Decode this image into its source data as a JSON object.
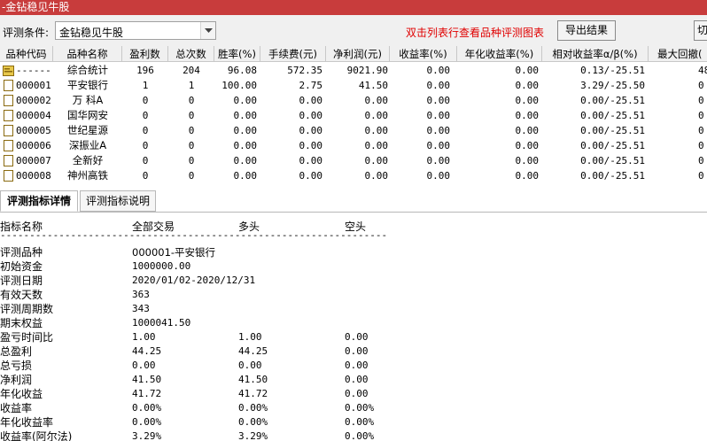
{
  "window": {
    "title": "-金钻稳见牛股"
  },
  "toolbar": {
    "condition_label": "评测条件:",
    "condition_value": "金钻稳见牛股",
    "hint": "双击列表行查看品种评测图表",
    "export_label": "导出结果",
    "cut_label": "切"
  },
  "table": {
    "columns": [
      "品种代码",
      "品种名称",
      "盈利数",
      "总次数",
      "胜率(%)",
      "手续费(元)",
      "净利润(元)",
      "收益率(%)",
      "年化收益率(%)",
      "相对收益率α/β(%)",
      "最大回撤("
    ],
    "rows": [
      {
        "code": "------",
        "name": "综合统计",
        "wins": "196",
        "total": "204",
        "winrate": "96.08",
        "fee": "572.35",
        "profit": "9021.90",
        "yield": "0.00",
        "annual": "0.00",
        "relative": "0.13/-25.51",
        "drawdown": "48"
      },
      {
        "code": "000001",
        "name": "平安银行",
        "wins": "1",
        "total": "1",
        "winrate": "100.00",
        "fee": "2.75",
        "profit": "41.50",
        "yield": "0.00",
        "annual": "0.00",
        "relative": "3.29/-25.50",
        "drawdown": "0"
      },
      {
        "code": "000002",
        "name": "万 科A",
        "wins": "0",
        "total": "0",
        "winrate": "0.00",
        "fee": "0.00",
        "profit": "0.00",
        "yield": "0.00",
        "annual": "0.00",
        "relative": "0.00/-25.51",
        "drawdown": "0"
      },
      {
        "code": "000004",
        "name": "国华网安",
        "wins": "0",
        "total": "0",
        "winrate": "0.00",
        "fee": "0.00",
        "profit": "0.00",
        "yield": "0.00",
        "annual": "0.00",
        "relative": "0.00/-25.51",
        "drawdown": "0"
      },
      {
        "code": "000005",
        "name": "世纪星源",
        "wins": "0",
        "total": "0",
        "winrate": "0.00",
        "fee": "0.00",
        "profit": "0.00",
        "yield": "0.00",
        "annual": "0.00",
        "relative": "0.00/-25.51",
        "drawdown": "0"
      },
      {
        "code": "000006",
        "name": "深振业A",
        "wins": "0",
        "total": "0",
        "winrate": "0.00",
        "fee": "0.00",
        "profit": "0.00",
        "yield": "0.00",
        "annual": "0.00",
        "relative": "0.00/-25.51",
        "drawdown": "0"
      },
      {
        "code": "000007",
        "name": "全新好",
        "wins": "0",
        "total": "0",
        "winrate": "0.00",
        "fee": "0.00",
        "profit": "0.00",
        "yield": "0.00",
        "annual": "0.00",
        "relative": "0.00/-25.51",
        "drawdown": "0"
      },
      {
        "code": "000008",
        "name": "神州高铁",
        "wins": "0",
        "total": "0",
        "winrate": "0.00",
        "fee": "0.00",
        "profit": "0.00",
        "yield": "0.00",
        "annual": "0.00",
        "relative": "0.00/-25.51",
        "drawdown": "0"
      }
    ]
  },
  "tabs": [
    "评测指标详情",
    "评测指标说明"
  ],
  "detail": {
    "headers": [
      "指标名称",
      "全部交易",
      "多头",
      "空头"
    ],
    "separator": "------------------------------------------------------------------------",
    "rows": [
      {
        "label": "评测品种",
        "all": "000001-平安银行",
        "long": "",
        "short": ""
      },
      {
        "label": "初始资金",
        "all": "1000000.00",
        "long": "",
        "short": ""
      },
      {
        "label": "评测日期",
        "all": "2020/01/02-2020/12/31",
        "long": "",
        "short": ""
      },
      {
        "label": "有效天数",
        "all": "363",
        "long": "",
        "short": ""
      },
      {
        "label": "评测周期数",
        "all": "343",
        "long": "",
        "short": ""
      },
      {
        "label": "期末权益",
        "all": "1000041.50",
        "long": "",
        "short": ""
      },
      {
        "label": "盈亏时间比",
        "all": "1.00",
        "long": "1.00",
        "short": "0.00"
      },
      {
        "label": "总盈利",
        "all": "44.25",
        "long": "44.25",
        "short": "0.00"
      },
      {
        "label": "总亏损",
        "all": "0.00",
        "long": "0.00",
        "short": "0.00"
      },
      {
        "label": "净利润",
        "all": "41.50",
        "long": "41.50",
        "short": "0.00"
      },
      {
        "label": "年化收益",
        "all": "41.72",
        "long": "41.72",
        "short": "0.00"
      },
      {
        "label": "收益率",
        "all": "0.00%",
        "long": "0.00%",
        "short": "0.00%"
      },
      {
        "label": "年化收益率",
        "all": "0.00%",
        "long": "0.00%",
        "short": "0.00%"
      },
      {
        "label": "收益率(阿尔法)",
        "all": "3.29%",
        "long": "3.29%",
        "short": "0.00%"
      }
    ]
  },
  "colors": {
    "titlebar": "#c83c3c",
    "hint": "#e00000",
    "summary_icon": "#e8c84a"
  },
  "icons": {
    "summary_row": "folder-chart-icon",
    "stock_row": "document-icon",
    "dropdown": "chevron-down-icon"
  }
}
